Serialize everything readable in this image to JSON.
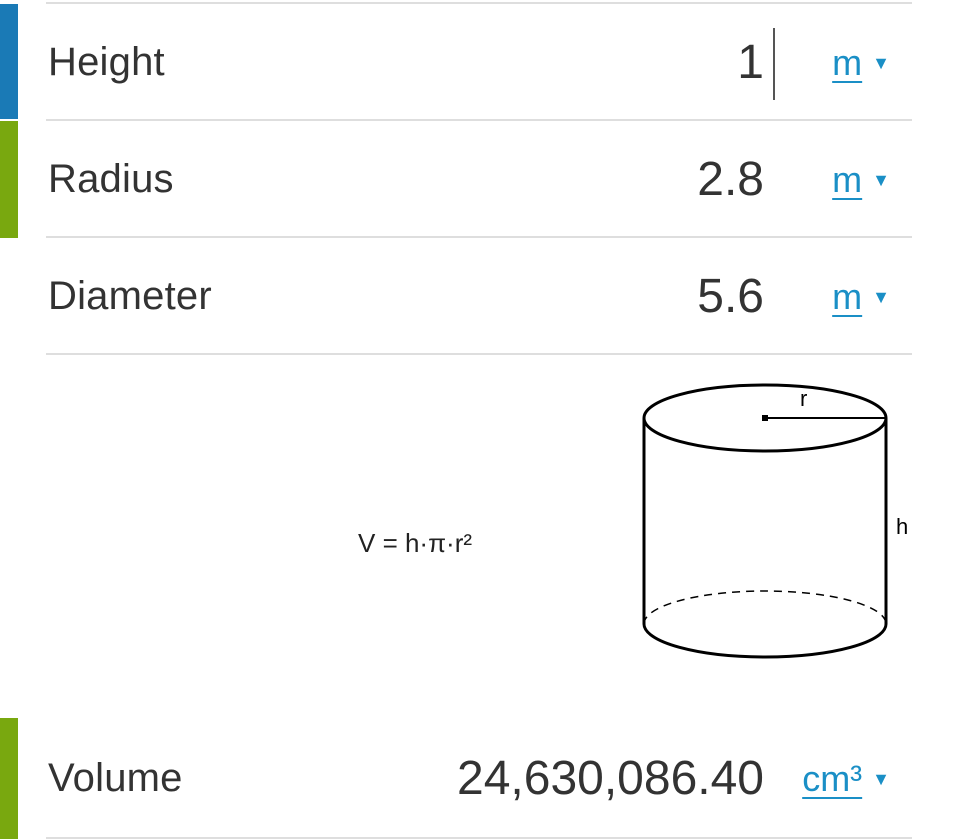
{
  "colors": {
    "height_accent": "#1a7ab6",
    "radius_accent": "#79a80f",
    "volume_accent": "#79a80f",
    "unit_link": "#1a8fc6",
    "divider": "#dedede",
    "text": "#333333"
  },
  "fields": [
    {
      "label": "Height",
      "value": "1",
      "unit": "m"
    },
    {
      "label": "Radius",
      "value": "2.8",
      "unit": "m"
    },
    {
      "label": "Diameter",
      "value": "5.6",
      "unit": "m"
    }
  ],
  "diagram": {
    "formula": "V = h·π·r²",
    "radius_label": "r",
    "height_label": "h"
  },
  "result": {
    "label": "Volume",
    "value": "24,630,086.40",
    "unit": "cm³"
  },
  "icons": {
    "unit_dropdown": "caret-down-icon"
  }
}
